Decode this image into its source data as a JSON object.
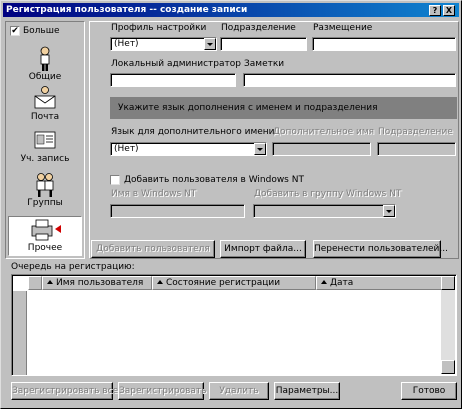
{
  "window": {
    "title": "Регистрация пользователя -- создание записи",
    "help_btn": "?",
    "close_btn": "X"
  },
  "sidebar": {
    "more_label": "Больше",
    "more_checked": "✔",
    "items": [
      {
        "label": "Общие",
        "icon": "person-icon"
      },
      {
        "label": "Почта",
        "icon": "mail-icon"
      },
      {
        "label": "Уч. запись",
        "icon": "id-card-icon"
      },
      {
        "label": "Группы",
        "icon": "group-icon"
      },
      {
        "label": "Прочее",
        "icon": "printer-icon"
      }
    ]
  },
  "form": {
    "profile_label": "Профиль настройки",
    "profile_value": "(Нет)",
    "department_label": "Подразделение",
    "department_value": "",
    "location_label": "Размещение",
    "location_value": "",
    "local_admin_label": "Локальный администратор",
    "local_admin_value": "",
    "notes_label": "Заметки",
    "notes_value": "",
    "banner_text": "Укажите язык дополнения с именем и подразделения",
    "extra_lang_label": "Язык для дополнительного имени",
    "extra_lang_value": "(Нет)",
    "extra_name_label": "Дополнительное имя",
    "extra_dept_label": "Подразделение",
    "add_nt_label": "Добавить пользователя в Windows NT",
    "nt_name_label": "Имя в Windows NT",
    "nt_group_label": "Добавить в группу Windows NT"
  },
  "actions": {
    "add_user": "Добавить пользователя",
    "import_file": "Импорт файла...",
    "move_users": "Перенести пользователей..."
  },
  "queue": {
    "label": "Очередь на регистрацию:",
    "columns": [
      "Имя пользователя",
      "Состояние регистрации",
      "Дата"
    ]
  },
  "footer": {
    "register_all": "Зарегистрировать все",
    "register": "Зарегистрировать",
    "delete": "Удалить",
    "params": "Параметры...",
    "done": "Готово"
  }
}
